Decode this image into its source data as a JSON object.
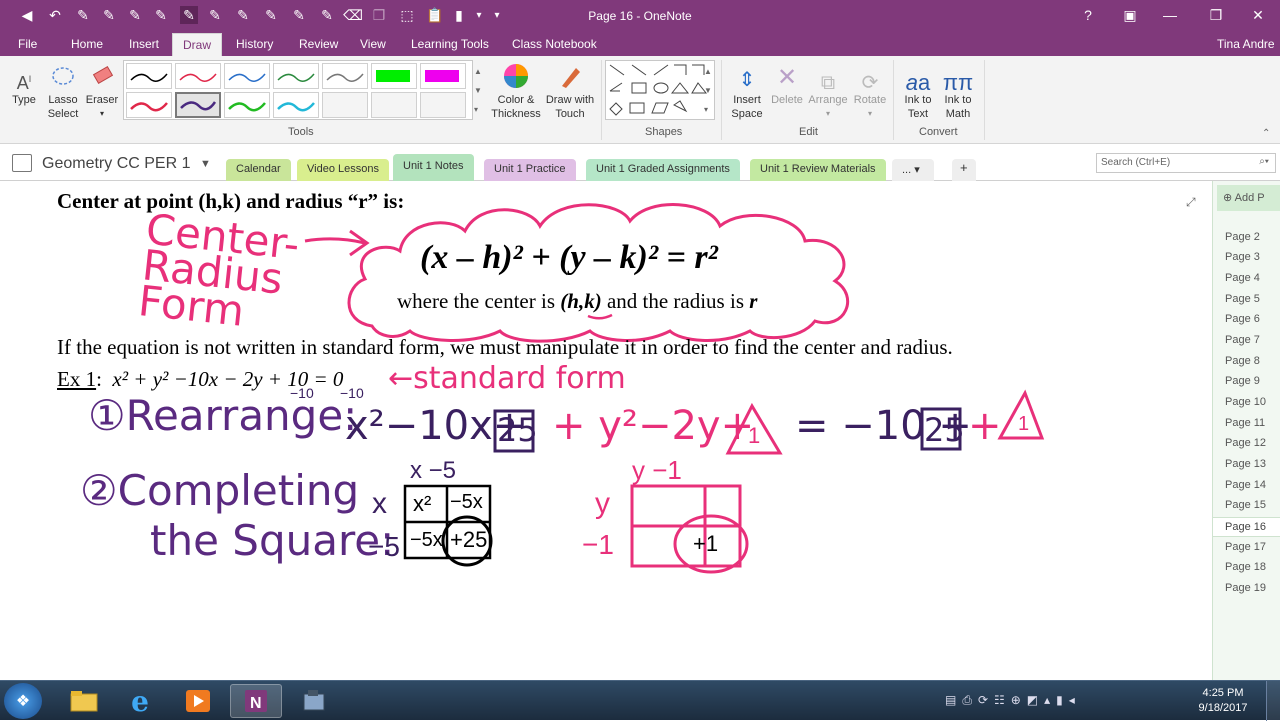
{
  "window": {
    "title": "Page 16 - OneNote",
    "user": "Tina Andre",
    "help": "?"
  },
  "ribbon_tabs": [
    "File",
    "Home",
    "Insert",
    "Draw",
    "History",
    "Review",
    "View",
    "Learning Tools",
    "Class Notebook"
  ],
  "ribbon": {
    "tools": {
      "type": "Type",
      "lasso_1": "Lasso",
      "lasso_2": "Select",
      "eraser": "Eraser",
      "color_1": "Color &",
      "color_2": "Thickness",
      "draw_touch_1": "Draw with",
      "draw_touch_2": "Touch",
      "group": "Tools"
    },
    "shapes_group": "Shapes",
    "edit": {
      "insert_1": "Insert",
      "insert_2": "Space",
      "delete": "Delete",
      "arrange": "Arrange",
      "rotate": "Rotate",
      "group": "Edit"
    },
    "convert": {
      "ink_text_1": "Ink to",
      "ink_text_2": "Text",
      "ink_math_1": "Ink to",
      "ink_math_2": "Math",
      "group": "Convert"
    },
    "pen_colors": [
      "#000000",
      "#e0284a",
      "#2a6fc9",
      "#2b8a3e",
      "#777777",
      "#00ee00",
      "#ee00ee",
      "#e0284a",
      "#4a2a80",
      "#22bb22",
      "#22b8d8"
    ]
  },
  "notebook": {
    "name": "Geometry CC PER 1",
    "sections": [
      {
        "label": "Calendar",
        "color": "#c9e59a"
      },
      {
        "label": "Video Lessons",
        "color": "#d9ee8e"
      },
      {
        "label": "Unit 1 Notes",
        "color": "#b3e3bd"
      },
      {
        "label": "Unit 1 Practice",
        "color": "#e0bfe5"
      },
      {
        "label": "Unit 1 Graded Assignments",
        "color": "#b5e6c8"
      },
      {
        "label": "Unit 1 Review Materials",
        "color": "#c3e9a1"
      }
    ],
    "more": "...",
    "add": "+",
    "search_placeholder": "Search (Ctrl+E)"
  },
  "note": {
    "heading": "Center at point (h,k) and radius “r” is:",
    "formula": "(x – h)² + (y – k)² = r²",
    "where_1": "where the center is",
    "where_hk": "(h,k)",
    "where_2": "and the radius is",
    "where_r": "r",
    "paragraph": "If the equation is not written in standard form, we must manipulate it in order to find the center and radius.",
    "ex_label": "Ex 1",
    "ex_eq": "x² + y² −10x − 2y + 10 = 0",
    "ink": {
      "center_radius_form": "Center-Radius Form",
      "standard_form": "←standard form",
      "step1": "①Rearrange:",
      "step1_eq": "x²−10x+",
      "box25": "25",
      "step1_eq2": "+ y²−2y+",
      "tri": "1",
      "step1_eq3": "= −10 +",
      "step1_eq4": "+",
      "minus10": "−10",
      "step2a": "②Completing",
      "step2b": "the Square:",
      "x_top": "x −5",
      "x_side": "x",
      "m5_side": "−5",
      "cell_x2": "x²",
      "cell_m5x": "−5x",
      "cell_25": "+25",
      "y_top": "y  −1",
      "y_side": "y",
      "m1_side": "−1",
      "cell_p1": "+1"
    }
  },
  "pages": {
    "add": "Add P",
    "list": [
      "Page 2",
      "Page 3",
      "Page 4",
      "Page 5",
      "Page 6",
      "Page 7",
      "Page 8",
      "Page 9",
      "Page 10",
      "Page 11",
      "Page 12",
      "Page 13",
      "Page 14",
      "Page 15",
      "Page 16",
      "Page 17",
      "Page 18",
      "Page 19"
    ],
    "current": "Page 16"
  },
  "taskbar": {
    "time": "4:25 PM",
    "date": "9/18/2017"
  }
}
